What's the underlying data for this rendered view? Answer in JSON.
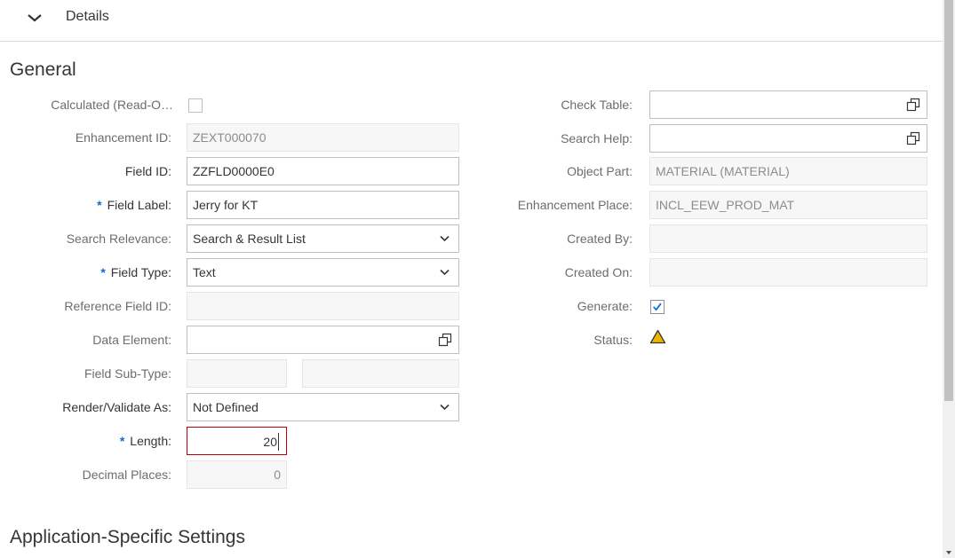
{
  "panel": {
    "title": "Details"
  },
  "general": {
    "title": "General",
    "calculated": {
      "label": "Calculated (Read-O…",
      "checked": false
    },
    "enhancement_id": {
      "label": "Enhancement ID:",
      "value": "ZEXT000070"
    },
    "field_id": {
      "label": "Field ID:",
      "value": "ZZFLD0000E0"
    },
    "field_label": {
      "required": "*",
      "label": "Field Label:",
      "value": "Jerry for KT"
    },
    "search_relevance": {
      "label": "Search Relevance:",
      "value": "Search & Result List"
    },
    "field_type": {
      "required": "*",
      "label": "Field Type:",
      "value": "Text"
    },
    "reference_field_id": {
      "label": "Reference Field ID:",
      "value": ""
    },
    "data_element": {
      "label": "Data Element:",
      "value": ""
    },
    "field_sub_type": {
      "label": "Field Sub-Type:",
      "value1": "",
      "value2": ""
    },
    "render_validate": {
      "label": "Render/Validate As:",
      "value": "Not Defined"
    },
    "length": {
      "required": "*",
      "label": "Length:",
      "value": "20"
    },
    "decimal_places": {
      "label": "Decimal Places:",
      "value": "0"
    },
    "check_table": {
      "label": "Check Table:",
      "value": ""
    },
    "search_help": {
      "label": "Search Help:",
      "value": ""
    },
    "object_part": {
      "label": "Object Part:",
      "value": "MATERIAL (MATERIAL)"
    },
    "enhancement_place": {
      "label": "Enhancement Place:",
      "value": "INCL_EEW_PROD_MAT"
    },
    "created_by": {
      "label": "Created By:",
      "value": ""
    },
    "created_on": {
      "label": "Created On:",
      "value": ""
    },
    "generate": {
      "label": "Generate:",
      "checked": true
    },
    "status": {
      "label": "Status:",
      "icon": "warning-triangle-icon"
    }
  },
  "app_settings": {
    "title": "Application-Specific Settings"
  },
  "colors": {
    "accent": "#0a6ed1",
    "error": "#bb0000",
    "warning": "#e9b200"
  }
}
